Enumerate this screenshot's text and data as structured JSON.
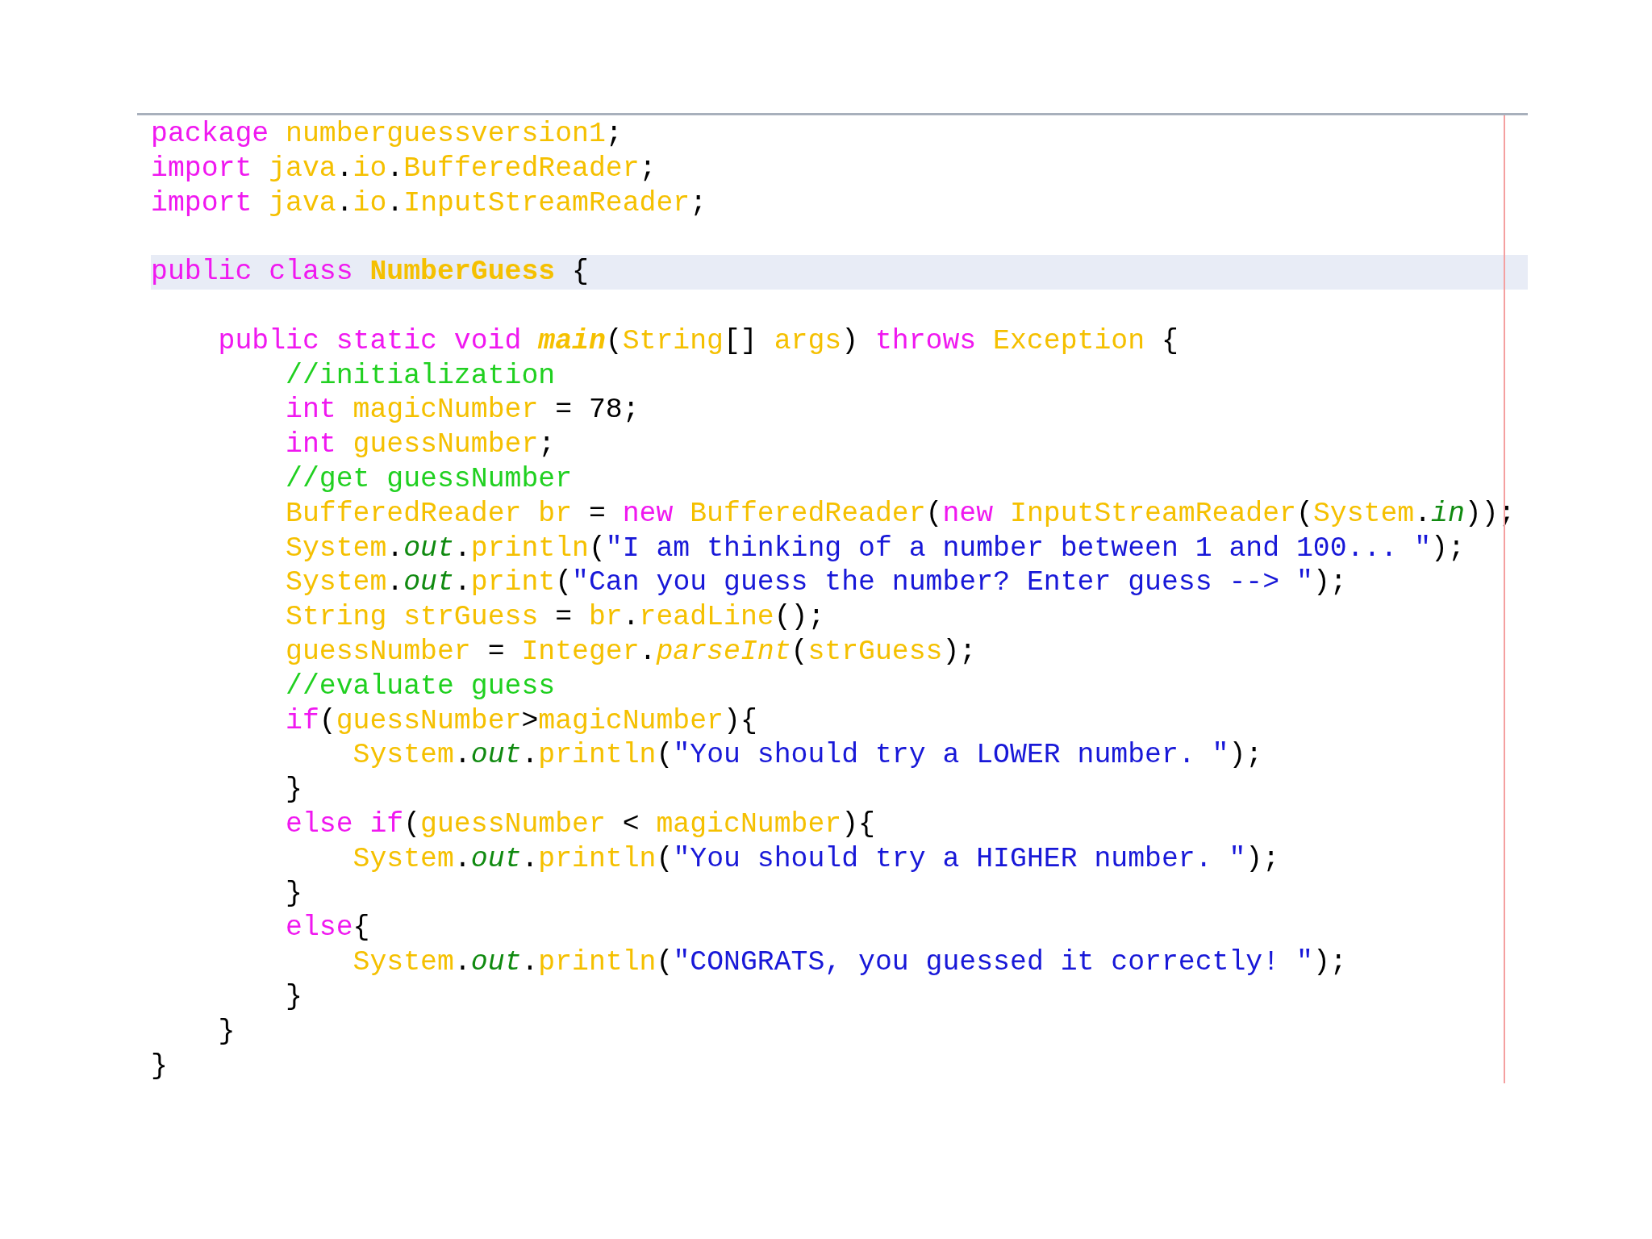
{
  "editor": {
    "lines": [
      {
        "kind": "code",
        "highlighted": false,
        "tokens": [
          {
            "text": "package ",
            "kind": "keyword"
          },
          {
            "text": "numberguessversion1",
            "kind": "ident"
          },
          {
            "text": ";",
            "kind": "plain"
          }
        ]
      },
      {
        "kind": "code",
        "highlighted": false,
        "tokens": [
          {
            "text": "import ",
            "kind": "keyword"
          },
          {
            "text": "java",
            "kind": "ident"
          },
          {
            "text": ".",
            "kind": "plain"
          },
          {
            "text": "io",
            "kind": "ident"
          },
          {
            "text": ".",
            "kind": "plain"
          },
          {
            "text": "BufferedReader",
            "kind": "ident"
          },
          {
            "text": ";",
            "kind": "plain"
          }
        ]
      },
      {
        "kind": "code",
        "highlighted": false,
        "tokens": [
          {
            "text": "import ",
            "kind": "keyword"
          },
          {
            "text": "java",
            "kind": "ident"
          },
          {
            "text": ".",
            "kind": "plain"
          },
          {
            "text": "io",
            "kind": "ident"
          },
          {
            "text": ".",
            "kind": "plain"
          },
          {
            "text": "InputStreamReader",
            "kind": "ident"
          },
          {
            "text": ";",
            "kind": "plain"
          }
        ]
      },
      {
        "kind": "blank"
      },
      {
        "kind": "code",
        "highlighted": true,
        "tokens": [
          {
            "text": "public class ",
            "kind": "keyword"
          },
          {
            "text": "NumberGuess",
            "kind": "declaration"
          },
          {
            "text": " {",
            "kind": "plain"
          }
        ],
        "children": [
          {
            "kind": "blank"
          },
          {
            "kind": "code",
            "highlighted": false,
            "tokens": [
              {
                "text": "public static void ",
                "kind": "keyword"
              },
              {
                "text": "main",
                "kind": "method_declaration"
              },
              {
                "text": "(",
                "kind": "plain"
              },
              {
                "text": "String",
                "kind": "ident"
              },
              {
                "text": "[] ",
                "kind": "plain"
              },
              {
                "text": "args",
                "kind": "ident"
              },
              {
                "text": ") ",
                "kind": "plain"
              },
              {
                "text": "throws ",
                "kind": "keyword"
              },
              {
                "text": "Exception",
                "kind": "ident"
              },
              {
                "text": " {",
                "kind": "plain"
              }
            ],
            "children": [
              {
                "kind": "code",
                "highlighted": false,
                "tokens": [
                  {
                    "text": "//initialization",
                    "kind": "comment"
                  }
                ]
              },
              {
                "kind": "code",
                "highlighted": false,
                "tokens": [
                  {
                    "text": "int ",
                    "kind": "keyword"
                  },
                  {
                    "text": "magicNumber",
                    "kind": "ident"
                  },
                  {
                    "text": " = 78;",
                    "kind": "plain"
                  }
                ]
              },
              {
                "kind": "code",
                "highlighted": false,
                "tokens": [
                  {
                    "text": "int ",
                    "kind": "keyword"
                  },
                  {
                    "text": "guessNumber",
                    "kind": "ident"
                  },
                  {
                    "text": ";",
                    "kind": "plain"
                  }
                ]
              },
              {
                "kind": "code",
                "highlighted": false,
                "tokens": [
                  {
                    "text": "//get guessNumber",
                    "kind": "comment"
                  }
                ]
              },
              {
                "kind": "code",
                "highlighted": false,
                "tokens": [
                  {
                    "text": "BufferedReader br",
                    "kind": "ident"
                  },
                  {
                    "text": " = ",
                    "kind": "plain"
                  },
                  {
                    "text": "new ",
                    "kind": "keyword"
                  },
                  {
                    "text": "BufferedReader",
                    "kind": "ident"
                  },
                  {
                    "text": "(",
                    "kind": "plain"
                  },
                  {
                    "text": "new ",
                    "kind": "keyword"
                  },
                  {
                    "text": "InputStreamReader",
                    "kind": "ident"
                  },
                  {
                    "text": "(",
                    "kind": "plain"
                  },
                  {
                    "text": "System",
                    "kind": "ident"
                  },
                  {
                    "text": ".",
                    "kind": "plain"
                  },
                  {
                    "text": "in",
                    "kind": "static_field"
                  },
                  {
                    "text": "));",
                    "kind": "plain"
                  }
                ]
              },
              {
                "kind": "code",
                "highlighted": false,
                "tokens": [
                  {
                    "text": "System",
                    "kind": "ident"
                  },
                  {
                    "text": ".",
                    "kind": "plain"
                  },
                  {
                    "text": "out",
                    "kind": "static_field"
                  },
                  {
                    "text": ".",
                    "kind": "plain"
                  },
                  {
                    "text": "println",
                    "kind": "ident"
                  },
                  {
                    "text": "(",
                    "kind": "plain"
                  },
                  {
                    "text": "\"I am thinking of a number between 1 and 100... \"",
                    "kind": "string"
                  },
                  {
                    "text": ");",
                    "kind": "plain"
                  }
                ]
              },
              {
                "kind": "code",
                "highlighted": false,
                "tokens": [
                  {
                    "text": "System",
                    "kind": "ident"
                  },
                  {
                    "text": ".",
                    "kind": "plain"
                  },
                  {
                    "text": "out",
                    "kind": "static_field"
                  },
                  {
                    "text": ".",
                    "kind": "plain"
                  },
                  {
                    "text": "print",
                    "kind": "ident"
                  },
                  {
                    "text": "(",
                    "kind": "plain"
                  },
                  {
                    "text": "\"Can you guess the number? Enter guess --> \"",
                    "kind": "string"
                  },
                  {
                    "text": ");",
                    "kind": "plain"
                  }
                ]
              },
              {
                "kind": "code",
                "highlighted": false,
                "tokens": [
                  {
                    "text": "String strGuess",
                    "kind": "ident"
                  },
                  {
                    "text": " = ",
                    "kind": "plain"
                  },
                  {
                    "text": "br",
                    "kind": "ident"
                  },
                  {
                    "text": ".",
                    "kind": "plain"
                  },
                  {
                    "text": "readLine",
                    "kind": "ident"
                  },
                  {
                    "text": "();",
                    "kind": "plain"
                  }
                ]
              },
              {
                "kind": "code",
                "highlighted": false,
                "tokens": [
                  {
                    "text": "guessNumber",
                    "kind": "ident"
                  },
                  {
                    "text": " = ",
                    "kind": "plain"
                  },
                  {
                    "text": "Integer",
                    "kind": "ident"
                  },
                  {
                    "text": ".",
                    "kind": "plain"
                  },
                  {
                    "text": "parseInt",
                    "kind": "static_method"
                  },
                  {
                    "text": "(",
                    "kind": "plain"
                  },
                  {
                    "text": "strGuess",
                    "kind": "ident"
                  },
                  {
                    "text": ");",
                    "kind": "plain"
                  }
                ]
              },
              {
                "kind": "code",
                "highlighted": false,
                "tokens": [
                  {
                    "text": "//evaluate guess",
                    "kind": "comment"
                  }
                ]
              },
              {
                "kind": "code",
                "highlighted": false,
                "tokens": [
                  {
                    "text": "if",
                    "kind": "keyword"
                  },
                  {
                    "text": "(",
                    "kind": "plain"
                  },
                  {
                    "text": "guessNumber",
                    "kind": "ident"
                  },
                  {
                    "text": ">",
                    "kind": "plain"
                  },
                  {
                    "text": "magicNumber",
                    "kind": "ident"
                  },
                  {
                    "text": "){",
                    "kind": "plain"
                  }
                ],
                "children": [
                  {
                    "kind": "code",
                    "highlighted": false,
                    "tokens": [
                      {
                        "text": "System",
                        "kind": "ident"
                      },
                      {
                        "text": ".",
                        "kind": "plain"
                      },
                      {
                        "text": "out",
                        "kind": "static_field"
                      },
                      {
                        "text": ".",
                        "kind": "plain"
                      },
                      {
                        "text": "println",
                        "kind": "ident"
                      },
                      {
                        "text": "(",
                        "kind": "plain"
                      },
                      {
                        "text": "\"You should try a LOWER number. \"",
                        "kind": "string"
                      },
                      {
                        "text": ");",
                        "kind": "plain"
                      }
                    ]
                  }
                ]
              },
              {
                "kind": "code",
                "highlighted": false,
                "tokens": [
                  {
                    "text": "}",
                    "kind": "plain"
                  }
                ]
              },
              {
                "kind": "code",
                "highlighted": false,
                "tokens": [
                  {
                    "text": "else if",
                    "kind": "keyword"
                  },
                  {
                    "text": "(",
                    "kind": "plain"
                  },
                  {
                    "text": "guessNumber",
                    "kind": "ident"
                  },
                  {
                    "text": " < ",
                    "kind": "plain"
                  },
                  {
                    "text": "magicNumber",
                    "kind": "ident"
                  },
                  {
                    "text": "){",
                    "kind": "plain"
                  }
                ],
                "children": [
                  {
                    "kind": "code",
                    "highlighted": false,
                    "tokens": [
                      {
                        "text": "System",
                        "kind": "ident"
                      },
                      {
                        "text": ".",
                        "kind": "plain"
                      },
                      {
                        "text": "out",
                        "kind": "static_field"
                      },
                      {
                        "text": ".",
                        "kind": "plain"
                      },
                      {
                        "text": "println",
                        "kind": "ident"
                      },
                      {
                        "text": "(",
                        "kind": "plain"
                      },
                      {
                        "text": "\"You should try a HIGHER number. \"",
                        "kind": "string"
                      },
                      {
                        "text": ");",
                        "kind": "plain"
                      }
                    ]
                  }
                ]
              },
              {
                "kind": "code",
                "highlighted": false,
                "tokens": [
                  {
                    "text": "}",
                    "kind": "plain"
                  }
                ]
              },
              {
                "kind": "code",
                "highlighted": false,
                "tokens": [
                  {
                    "text": "else",
                    "kind": "keyword"
                  },
                  {
                    "text": "{",
                    "kind": "plain"
                  }
                ],
                "children": [
                  {
                    "kind": "code",
                    "highlighted": false,
                    "tokens": [
                      {
                        "text": "System",
                        "kind": "ident"
                      },
                      {
                        "text": ".",
                        "kind": "plain"
                      },
                      {
                        "text": "out",
                        "kind": "static_field"
                      },
                      {
                        "text": ".",
                        "kind": "plain"
                      },
                      {
                        "text": "println",
                        "kind": "ident"
                      },
                      {
                        "text": "(",
                        "kind": "plain"
                      },
                      {
                        "text": "\"CONGRATS, you guessed it correctly! \"",
                        "kind": "string"
                      },
                      {
                        "text": ");",
                        "kind": "plain"
                      }
                    ]
                  }
                ]
              },
              {
                "kind": "code",
                "highlighted": false,
                "tokens": [
                  {
                    "text": "}",
                    "kind": "plain"
                  }
                ]
              }
            ]
          },
          {
            "kind": "code",
            "highlighted": false,
            "tokens": [
              {
                "text": "}",
                "kind": "plain"
              }
            ]
          }
        ]
      },
      {
        "kind": "code",
        "highlighted": false,
        "tokens": [
          {
            "text": "}",
            "kind": "plain"
          }
        ]
      }
    ]
  }
}
